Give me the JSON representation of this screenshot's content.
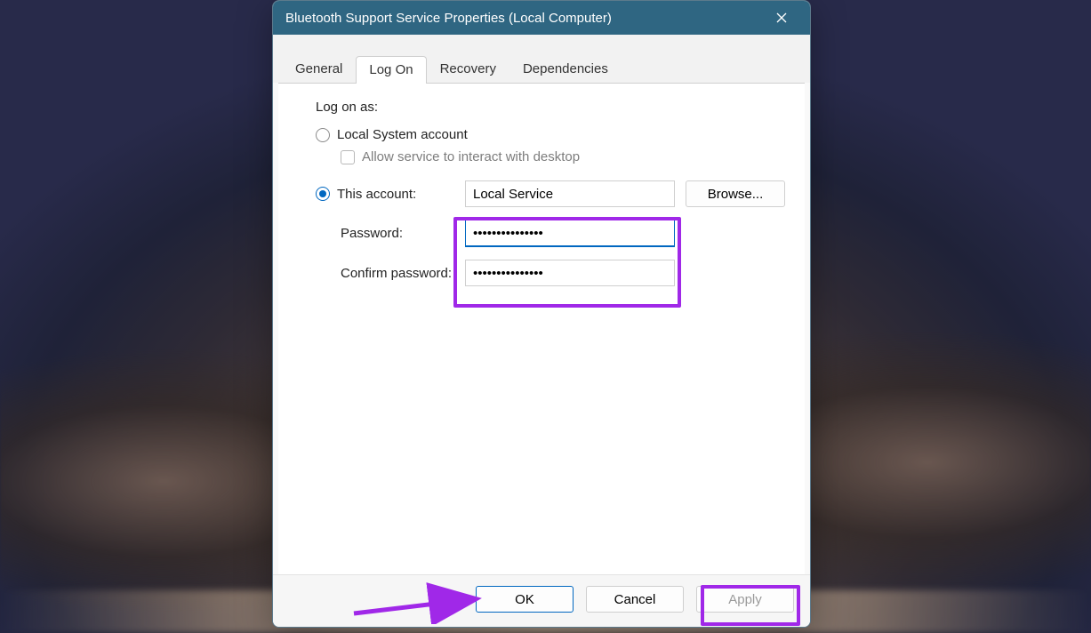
{
  "window": {
    "title": "Bluetooth Support Service Properties (Local Computer)"
  },
  "tabs": {
    "general": "General",
    "logon": "Log On",
    "recovery": "Recovery",
    "dependencies": "Dependencies"
  },
  "logon": {
    "section_label": "Log on as:",
    "local_system_label": "Local System account",
    "allow_interact_label": "Allow service to interact with desktop",
    "this_account_label": "This account:",
    "account_value": "Local Service",
    "browse_label": "Browse...",
    "password_label": "Password:",
    "password_value": "•••••••••••••••",
    "confirm_label": "Confirm password:",
    "confirm_value": "•••••••••••••••"
  },
  "buttons": {
    "ok": "OK",
    "cancel": "Cancel",
    "apply": "Apply"
  }
}
